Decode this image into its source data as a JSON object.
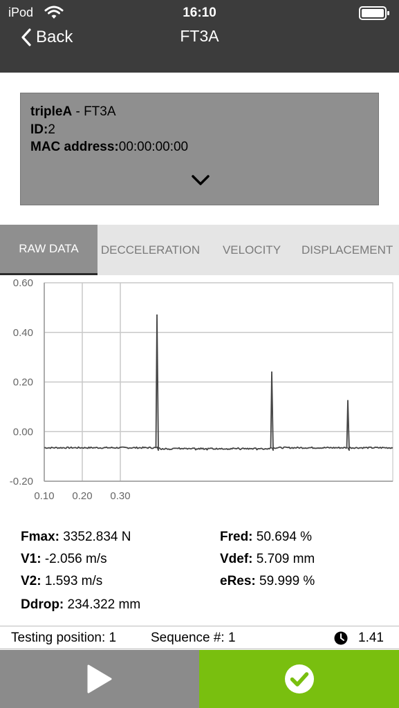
{
  "status": {
    "carrier": "iPod",
    "time": "16:10"
  },
  "nav": {
    "back_label": "Back",
    "title": "FT3A"
  },
  "device": {
    "name_bold": "tripleA",
    "name_rest": " - FT3A",
    "id_label": "ID:",
    "id_value": "2",
    "mac_label": "MAC address:",
    "mac_value": "00:00:00:00"
  },
  "tabs": [
    {
      "label": "RAW DATA",
      "active": true
    },
    {
      "label": "DECCELERATION",
      "active": false
    },
    {
      "label": "VELOCITY",
      "active": false
    },
    {
      "label": "DISPLACEMENT",
      "active": false
    }
  ],
  "chart_data": {
    "type": "line",
    "title": "",
    "xlabel": "",
    "ylabel": "",
    "ylim": [
      -0.2,
      0.6
    ],
    "y_ticks": [
      "0.60",
      "0.40",
      "0.20",
      "0.00",
      "-0.20"
    ],
    "x_ticks": [
      "0.10",
      "0.20",
      "0.30"
    ],
    "grid": true,
    "series": [
      {
        "color": "#444444",
        "baseline": -0.065,
        "peaks": [
          0.47,
          0.24,
          0.125
        ]
      }
    ]
  },
  "stats": {
    "fmax_label": "Fmax:",
    "fmax_value": "3352.834 N",
    "v1_label": "V1:",
    "v1_value": "-2.056 m/s",
    "v2_label": "V2:",
    "v2_value": "1.593 m/s",
    "ddrop_label": "Ddrop:",
    "ddrop_value": "234.322 mm",
    "fred_label": "Fred:",
    "fred_value": "50.694 %",
    "vdef_label": "Vdef:",
    "vdef_value": "5.709 mm",
    "eres_label": "eRes:",
    "eres_value": "59.999 %"
  },
  "info": {
    "testing_position": "Testing position: 1",
    "sequence": "Sequence #: 1",
    "elapsed": "1.41"
  },
  "colors": {
    "nav_bg": "#3c3c3c",
    "card_bg": "#8f8f8f",
    "play_bg": "#8b8b8b",
    "confirm_bg": "#79bf0f"
  },
  "icons": [
    "wifi-icon",
    "battery-icon",
    "chevron-left-icon",
    "chevron-down-icon",
    "clock-icon",
    "play-icon",
    "check-circle-icon"
  ]
}
